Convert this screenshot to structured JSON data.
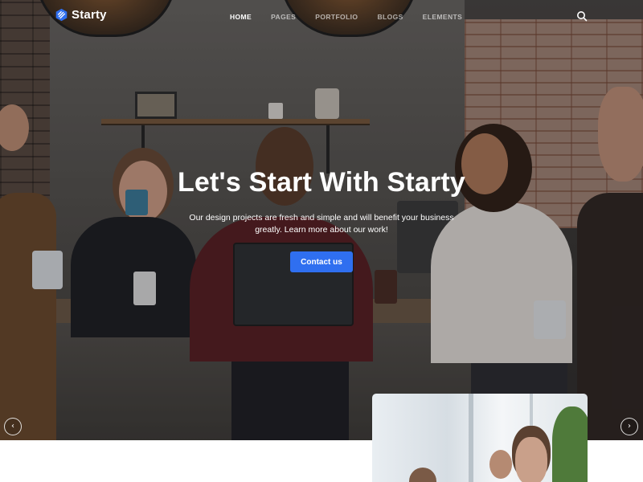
{
  "header": {
    "brand": "Starty",
    "logo_icon": "hexagon-logo-icon",
    "nav": [
      {
        "label": "HOME",
        "active": true
      },
      {
        "label": "PAGES",
        "active": false
      },
      {
        "label": "PORTFOLIO",
        "active": false
      },
      {
        "label": "BLOGS",
        "active": false
      },
      {
        "label": "ELEMENTS",
        "active": false
      }
    ],
    "search_icon": "search-icon"
  },
  "hero": {
    "title": "Let's Start With Starty",
    "subtitle_line1": "Our design projects are fresh and simple and will benefit your business",
    "subtitle_line2": "greatly. Learn more about our work!",
    "cta_label": "Contact us",
    "prev_glyph": "‹",
    "next_glyph": "›"
  },
  "colors": {
    "accent": "#2f6ff0",
    "text_on_dark": "#ffffff",
    "page_background": "#ffffff"
  }
}
